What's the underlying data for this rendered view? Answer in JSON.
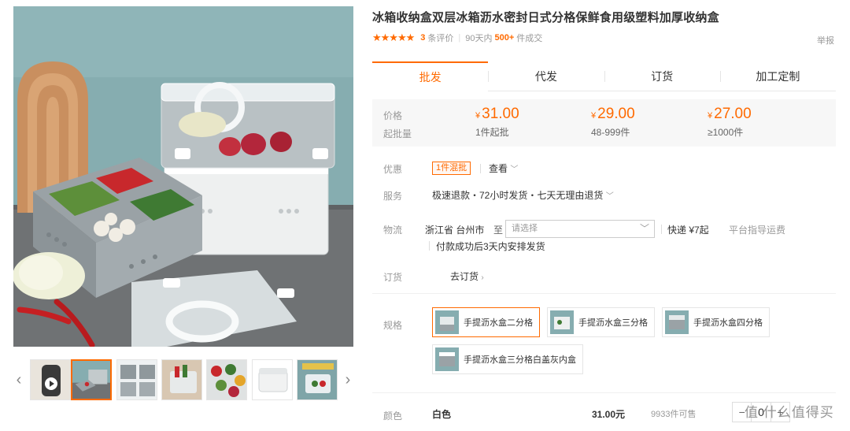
{
  "product": {
    "title": "冰箱收纳盒双层冰箱沥水密封日式分格保鲜食用级塑料加厚收纳盒",
    "stars": "★★★★★",
    "review_count": "3",
    "review_label": "条评价",
    "sold_period": "90天内",
    "sold_count": "500+",
    "sold_label": "件成交",
    "report": "举报"
  },
  "gallery": {
    "thumbnails": [
      "thumb-1",
      "thumb-2",
      "thumb-3",
      "thumb-4",
      "thumb-5",
      "thumb-6",
      "thumb-7"
    ],
    "active_index": 1,
    "prev_glyph": "‹",
    "next_glyph": "›"
  },
  "tabs": [
    "批发",
    "代发",
    "订货",
    "加工定制"
  ],
  "pricing": {
    "price_label": "价格",
    "moq_label": "起批量",
    "currency": "¥",
    "tiers": [
      {
        "price": "31.00",
        "range": "1件起批"
      },
      {
        "price": "29.00",
        "range": "48-999件"
      },
      {
        "price": "27.00",
        "range": "≥1000件"
      }
    ]
  },
  "promo": {
    "label": "优惠",
    "badge": "1件混批",
    "see_more": "查看"
  },
  "service": {
    "label": "服务",
    "text": "极速退款・72小时发货・七天无理由退货"
  },
  "logistics": {
    "label": "物流",
    "origin": "浙江省 台州市",
    "to": "至",
    "dest_placeholder": "请选择",
    "express": "快递 ¥7起",
    "guide": "平台指导运费",
    "note": "付款成功后3天内安排发货"
  },
  "order": {
    "label": "订货",
    "link": "去订货"
  },
  "spec": {
    "label": "规格",
    "options": [
      "手提沥水盒二分格",
      "手提沥水盒三分格",
      "手提沥水盒四分格",
      "手提沥水盒三分格白盖灰内盒"
    ],
    "selected_index": 0
  },
  "color": {
    "label": "颜色",
    "name": "白色",
    "price": "31.00元",
    "stock": "9933件可售"
  },
  "quantity": {
    "minus": "−",
    "value": "0",
    "plus": "+"
  },
  "watermark": "值 什么值得买",
  "colors": {
    "accent": "#ff6a00",
    "price_bg": "#f7f7f7",
    "muted": "#999999"
  }
}
